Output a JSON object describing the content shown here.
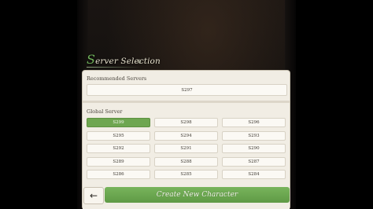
{
  "header": {
    "title_initial": "S",
    "title_rest": "erver Selection"
  },
  "recommended": {
    "label": "Recommended Servers",
    "servers": [
      "S297"
    ]
  },
  "global": {
    "label": "Global Server",
    "selected": "S299",
    "servers": [
      "S299",
      "S298",
      "S296",
      "S295",
      "S294",
      "S293",
      "S292",
      "S291",
      "S290",
      "S289",
      "S288",
      "S287",
      "S286",
      "S285",
      "S284"
    ]
  },
  "footer": {
    "back_icon": "arrow-left-icon",
    "back_glyph": "←",
    "create_label": "Create New Character"
  },
  "colors": {
    "accent_green": "#6ea650",
    "panel_bg": "#f1ede4"
  }
}
